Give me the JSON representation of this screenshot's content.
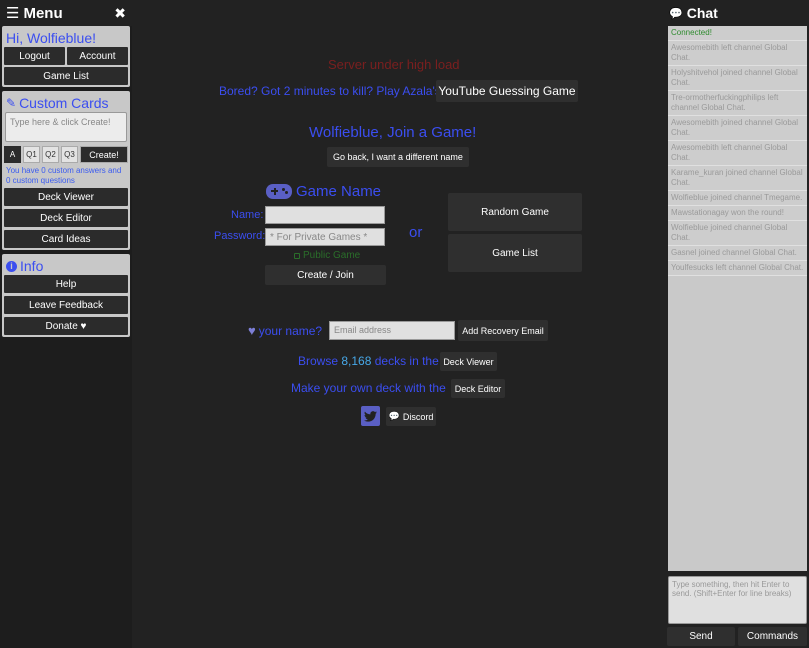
{
  "menu": {
    "title": "Menu",
    "greeting": "Hi, Wolfieblue!",
    "logout": "Logout",
    "account": "Account",
    "game_list": "Game List",
    "custom_cards": {
      "title": "Custom Cards",
      "placeholder": "Type here & click Create!",
      "buttons": [
        "A",
        "Q1",
        "Q2",
        "Q3"
      ],
      "create": "Create!",
      "note": "You have 0 custom answers and 0 custom questions",
      "deck_viewer": "Deck Viewer",
      "deck_editor": "Deck Editor",
      "card_ideas": "Card Ideas"
    },
    "info": {
      "title": "Info",
      "help": "Help",
      "feedback": "Leave Feedback",
      "donate": "Donate ♥"
    }
  },
  "main": {
    "banner": "Server under high load",
    "bored_text": "Bored? Got 2 minutes to kill? Play Azala's",
    "youtube_button": "YouTube Guessing Game",
    "join_title": "Wolfieblue, Join a Game!",
    "go_back": "Go back, I want a different name",
    "game_name_title": "Game Name",
    "name_label": "Name:",
    "password_label": "Password:",
    "password_placeholder": "* For Private Games *",
    "public_game": "Public Game",
    "create_join": "Create / Join",
    "or": "or",
    "random_game": "Random Game",
    "game_list": "Game List",
    "your_name": "your name?",
    "email_placeholder": "Email address",
    "add_recovery": "Add Recovery Email",
    "browse_prefix": "Browse",
    "deck_count": "8,168",
    "browse_suffix": "decks in the",
    "deck_viewer": "Deck Viewer",
    "make_deck": "Make your own deck with the",
    "deck_editor": "Deck Editor",
    "discord": "Discord"
  },
  "chat": {
    "title": "Chat",
    "messages": [
      "Connected!",
      "Awesomebith left channel Global Chat.",
      "Holyshitvehol joined channel Global Chat.",
      "Tre-ormotherfuckingphilips left channel Global Chat.",
      "Awesomebith joined channel Global Chat.",
      "Awesomebith left channel Global Chat.",
      "Karame_kuran joined channel Global Chat.",
      "Wolfieblue joined channel Tmegame.",
      "Mawstationagay won the round!",
      "Wolfieblue joined channel Global Chat.",
      "Gasnel joined channel Global Chat.",
      "Youlfesucks left channel Global Chat."
    ],
    "input_placeholder": "Type something, then hit Enter to send. (Shift+Enter for line breaks)",
    "send": "Send",
    "commands": "Commands"
  }
}
